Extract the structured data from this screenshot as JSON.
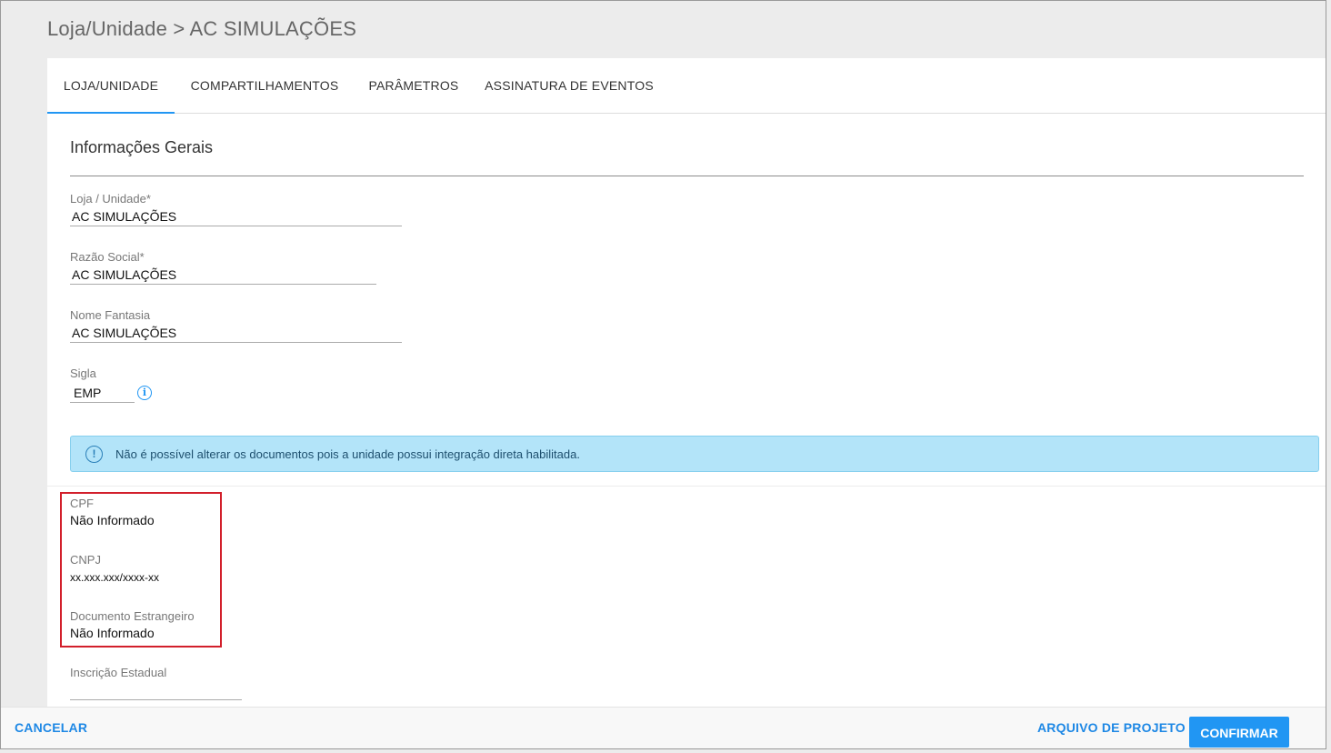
{
  "header": {
    "breadcrumb_section": "Loja/Unidade",
    "breadcrumb_separator": ">",
    "breadcrumb_current": "AC SIMULAÇÕES"
  },
  "tabs": [
    {
      "label": "LOJA/UNIDADE",
      "active": true
    },
    {
      "label": "COMPARTILHAMENTOS",
      "active": false
    },
    {
      "label": "PARÂMETROS",
      "active": false
    },
    {
      "label": "ASSINATURA DE EVENTOS",
      "active": false
    }
  ],
  "section": {
    "title": "Informações Gerais"
  },
  "fields": {
    "loja_unidade": {
      "label": "Loja / Unidade*",
      "value": "AC SIMULAÇÕES"
    },
    "razao_social": {
      "label": "Razão Social*",
      "value": "AC SIMULAÇÕES"
    },
    "nome_fantasia": {
      "label": "Nome Fantasia",
      "value": "AC SIMULAÇÕES"
    },
    "sigla": {
      "label": "Sigla",
      "value": "EMP"
    },
    "inscricao_estadual": {
      "label": "Inscrição Estadual",
      "value": ""
    }
  },
  "alert": {
    "icon": "info-circle-icon",
    "text": "Não é possível alterar os documentos pois a unidade possui integração direta habilitada."
  },
  "documents": {
    "cpf": {
      "label": "CPF",
      "value": "Não Informado"
    },
    "cnpj": {
      "label": "CNPJ",
      "value": "xx.xxx.xxx/xxxx-xx"
    },
    "documento_estrangeiro": {
      "label": "Documento Estrangeiro",
      "value": "Não Informado"
    }
  },
  "footer": {
    "cancel_label": "CANCELAR",
    "project_file_label": "ARQUIVO DE PROJETO",
    "confirm_label": "CONFIRMAR"
  },
  "colors": {
    "accent": "#2196f3",
    "alert_bg": "#b3e4f9",
    "highlight_border": "#d21f2b"
  }
}
